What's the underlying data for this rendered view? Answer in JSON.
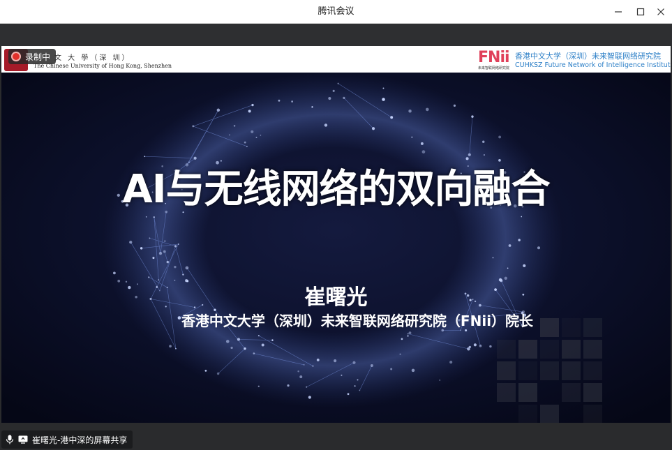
{
  "window": {
    "title": "腾讯会议",
    "min_icon": "minimize-icon",
    "max_icon": "maximize-icon",
    "close_icon": "close-icon"
  },
  "recording": {
    "label": "录制中",
    "icon": "record-icon"
  },
  "slide": {
    "header": {
      "left_cn": "文 大 學（深 圳）",
      "left_en": "The Chinese University of Hong Kong, Shenzhen",
      "right_logo": "FNii",
      "right_logo_sub": "未来智联网络研究院",
      "right_cn": "香港中文大学（深圳）未来智联网络研究院",
      "right_en": "CUHKSZ Future Network of Intelligence Institute"
    },
    "title": "AI与无线网络的双向融合",
    "presenter": "崔曙光",
    "affiliation": "香港中文大学（深圳）未来智联网络研究院（FNii）院长"
  },
  "share_tag": {
    "label": "崔曙光-港中深的屏幕共享",
    "mic_icon": "microphone-icon",
    "screen_icon": "screen-share-icon"
  },
  "colors": {
    "slide_bg": "#0a0e24",
    "network_glow": "#6f8fe0",
    "fnii_pink": "#e0405a",
    "fnii_blue": "#2c7fc7",
    "record_red": "#e0312b"
  }
}
